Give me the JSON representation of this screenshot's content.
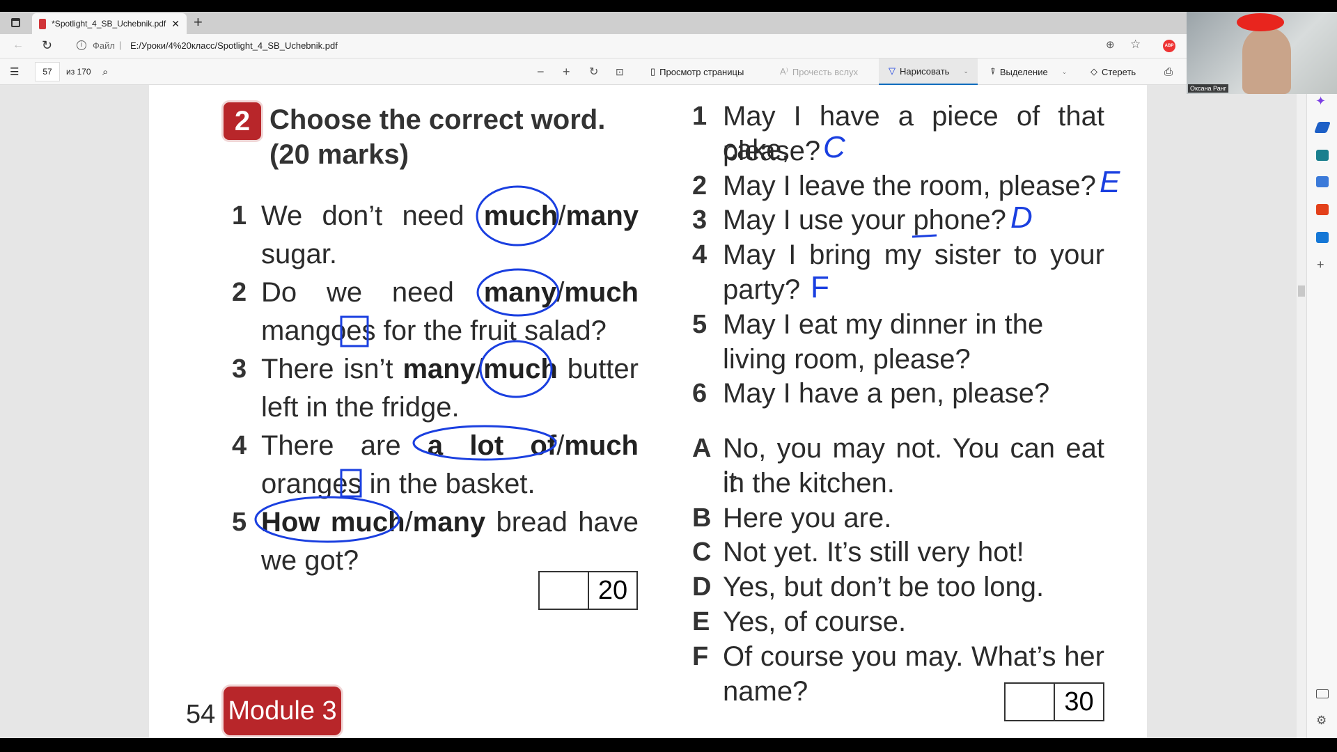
{
  "browser": {
    "tab_title": "*Spotlight_4_SB_Uchebnik.pdf",
    "address_prefix": "Файл",
    "address": "E:/Уроки/4%20класс/Spotlight_4_SB_Uchebnik.pdf",
    "extension_badge": "ABP"
  },
  "pdf_toolbar": {
    "page": "57",
    "of_pages": "из 170",
    "page_view": "Просмотр страницы",
    "read_aloud": "Прочесть вслух",
    "draw": "Нарисовать",
    "highlight": "Выделение",
    "erase": "Стереть"
  },
  "webcam": {
    "name": "Оксана Ранг"
  },
  "page": {
    "exercise_number": "2",
    "title": "Choose the correct word.",
    "marks": "(20 marks)",
    "left_items": [
      {
        "n": "1",
        "l1a": "We don’t need ",
        "w1": "much",
        "sep": "/",
        "w2": "many",
        "l2": "sugar."
      },
      {
        "n": "2",
        "l1a": "Do we need ",
        "w1": "many",
        "sep": "/",
        "w2": "much",
        "l2": "mangoes for the fruit salad?"
      },
      {
        "n": "3",
        "l1a": "There isn’t ",
        "w1": "many",
        "sep": "/",
        "w2": "much",
        "l1b": " butter",
        "l2": "left in the fridge."
      },
      {
        "n": "4",
        "l1a": "There are ",
        "w1": "a lot of",
        "sep": "/",
        "w2": "much",
        "l2": "oranges in the basket."
      },
      {
        "n": "5",
        "w1": "How much",
        "sep": "/",
        "w2": "many",
        "l1b": " bread have",
        "l2": "we got?"
      }
    ],
    "left_score": "20",
    "questions": [
      {
        "n": "1",
        "lines": [
          "May I have a piece of that cake,",
          "please?"
        ]
      },
      {
        "n": "2",
        "lines": [
          "May I leave the room, please?"
        ]
      },
      {
        "n": "3",
        "lines": [
          "May I use your phone?"
        ]
      },
      {
        "n": "4",
        "lines": [
          "May I bring my sister to your",
          "party?"
        ]
      },
      {
        "n": "5",
        "lines": [
          "May I eat my dinner in the",
          "living room, please?"
        ]
      },
      {
        "n": "6",
        "lines": [
          "May I have a pen, please?"
        ]
      }
    ],
    "answers": [
      {
        "n": "A",
        "lines": [
          "No, you may not. You can eat it",
          "in the kitchen."
        ]
      },
      {
        "n": "B",
        "lines": [
          "Here you are."
        ]
      },
      {
        "n": "C",
        "lines": [
          "Not yet. It’s still very hot!"
        ]
      },
      {
        "n": "D",
        "lines": [
          "Yes, but don’t be too long."
        ]
      },
      {
        "n": "E",
        "lines": [
          "Yes, of course."
        ]
      },
      {
        "n": "F",
        "lines": [
          "Of course you may. What’s her",
          "name?"
        ]
      }
    ],
    "right_score": "30",
    "page_number": "54",
    "module": "Module 3",
    "handwritten_answers": {
      "q1": "C",
      "q2": "E",
      "q3": "D",
      "q4": "F"
    }
  },
  "colors": {
    "ink": "#1a3fe0",
    "badge": "#b8262a",
    "accent": "#0f6cbd"
  }
}
